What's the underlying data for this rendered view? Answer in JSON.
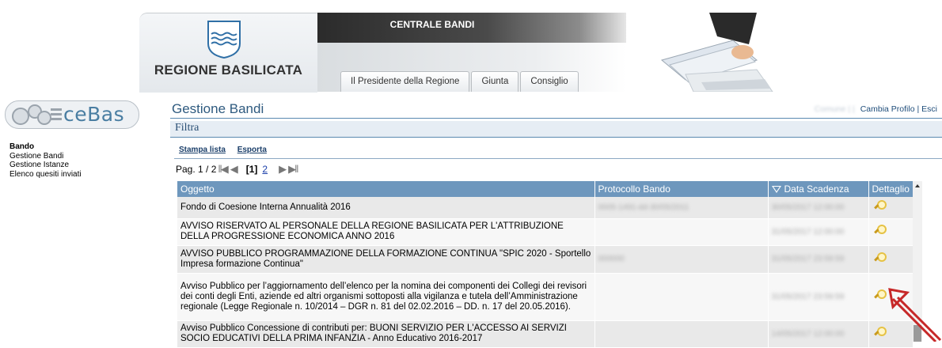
{
  "banner": {
    "region_name": "REGIONE BASILICATA",
    "portal_title": "CENTRALE BANDI",
    "tabs": [
      {
        "label": "Il Presidente della Regione"
      },
      {
        "label": "Giunta"
      },
      {
        "label": "Consiglio"
      }
    ]
  },
  "sidebar": {
    "app_name": "ceBas",
    "section": "Bando",
    "items": [
      {
        "label": "Gestione Bandi"
      },
      {
        "label": "Gestione Istanze"
      },
      {
        "label": "Elenco quesiti inviati"
      }
    ]
  },
  "main": {
    "title": "Gestione Bandi",
    "user_blur": "Comune | |",
    "change_profile": "Cambia Profilo",
    "separator": "|",
    "exit": "Esci",
    "filter_label": "Filtra",
    "actions": {
      "print": "Stampa lista",
      "export": "Esporta"
    },
    "pager": {
      "info": "Pag. 1 / 2",
      "current": "[1]",
      "next_page": "2"
    }
  },
  "table": {
    "headers": {
      "oggetto": "Oggetto",
      "protocollo": "Protocollo Bando",
      "scadenza": "Data Scadenza",
      "dettaglio": "Dettaglio"
    },
    "rows": [
      {
        "oggetto": "Fondo di Coesione Interna Annualità 2016",
        "protocollo": "0005-1491-dd-30/05/2011",
        "scadenza": "30/05/2017 12:00:00"
      },
      {
        "oggetto": "AVVISO RISERVATO AL PERSONALE DELLA REGIONE BASILICATA PER L'ATTRIBUZIONE DELLA PROGRESSIONE ECONOMICA ANNO 2016",
        "protocollo": "",
        "scadenza": "31/05/2017 12:00:00"
      },
      {
        "oggetto": "AVVISO PUBBLICO PROGRAMMAZIONE DELLA FORMAZIONE CONTINUA \"SPIC 2020 - Sportello Impresa formazione Continua\"",
        "protocollo": "000000",
        "scadenza": "31/05/2017 23:59:59"
      },
      {
        "oggetto": "Avviso Pubblico per l’aggiornamento dell’elenco per la nomina dei componenti dei Collegi dei revisori dei conti degli Enti, aziende ed altri organismi sottoposti alla vigilanza e tutela dell’Amministrazione regionale (Legge Regionale n. 10/2014 – DGR n. 81 del 02.02.2016 – DD. n. 17 del 20.05.2016).",
        "protocollo": "",
        "scadenza": "31/05/2017 23:59:59"
      },
      {
        "oggetto": "Avviso Pubblico Concessione di contributi per: BUONI SERVIZIO PER L'ACCESSO AI SERVIZI SOCIO EDUCATIVI DELLA PRIMA INFANZIA - Anno Educativo 2016-2017",
        "protocollo": "",
        "scadenza": "14/05/2017 12:00:00"
      }
    ]
  },
  "colors": {
    "header_blue": "#6e97bd",
    "title_blue": "#2e5a7f",
    "link_blue": "#1a3e69",
    "arrow_red": "#c62828"
  }
}
